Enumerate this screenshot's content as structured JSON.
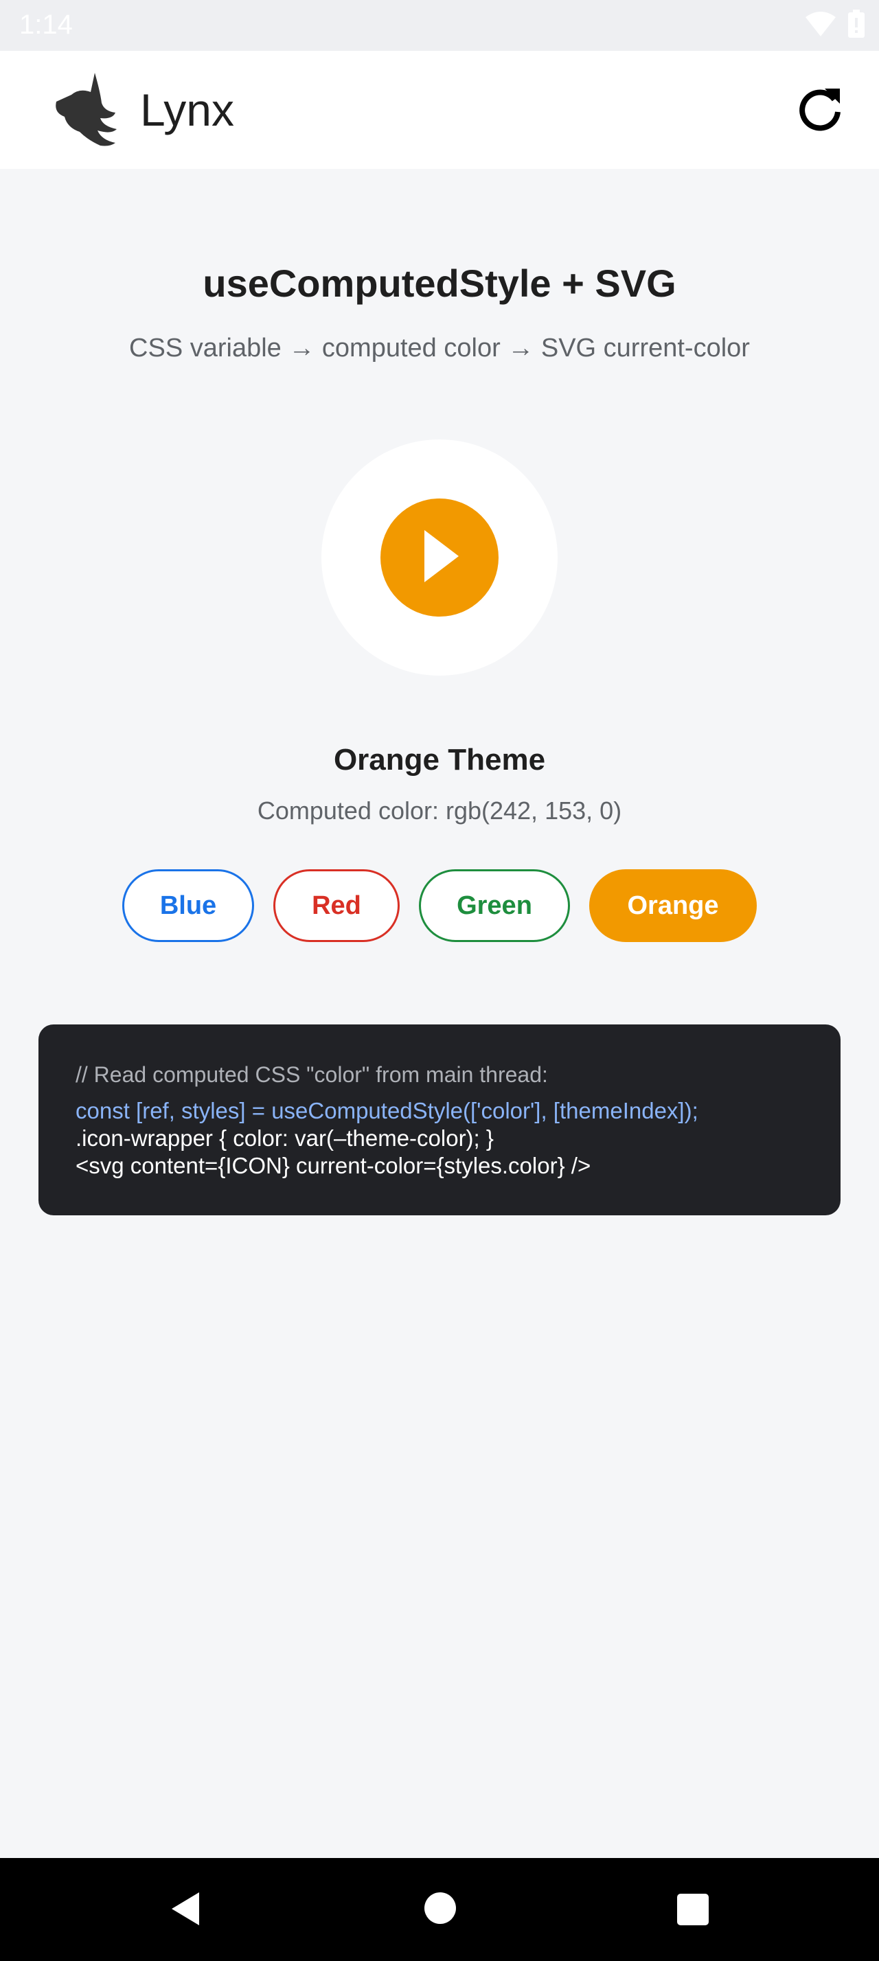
{
  "status_bar": {
    "time": "1:14",
    "icons": [
      "wifi-icon",
      "battery-icon"
    ]
  },
  "app_bar": {
    "title": "Lynx",
    "logo_icon": "lynx-logo-icon",
    "refresh_icon": "refresh-icon"
  },
  "main": {
    "heading": "useComputedStyle + SVG",
    "subheading": "CSS variable → computed color → SVG current-color",
    "icon": "play-icon",
    "theme_name": "Orange Theme",
    "computed_color": "Computed color: rgb(242, 153, 0)",
    "theme_buttons": [
      {
        "label": "Blue",
        "color": "#1a73e8",
        "selected": false
      },
      {
        "label": "Red",
        "color": "#d93025",
        "selected": false
      },
      {
        "label": "Green",
        "color": "#1e8e3e",
        "selected": false
      },
      {
        "label": "Orange",
        "color": "#f29900",
        "selected": true
      }
    ]
  },
  "code": {
    "comment": "// Read computed CSS \"color\" from main thread:",
    "lines": [
      "const [ref, styles] = useComputedStyle(['color'], [themeIndex]);",
      ".icon-wrapper { color: var(–theme-color); }",
      "<svg content={ICON} current-color={styles.color} />"
    ]
  },
  "colors": {
    "accent": "#f29900",
    "page_background": "#f5f6f8",
    "code_background": "#212226",
    "code_highlight": "#8ab4f8"
  },
  "nav_bar": {
    "icons": [
      "back-icon",
      "home-icon",
      "recents-icon"
    ]
  }
}
